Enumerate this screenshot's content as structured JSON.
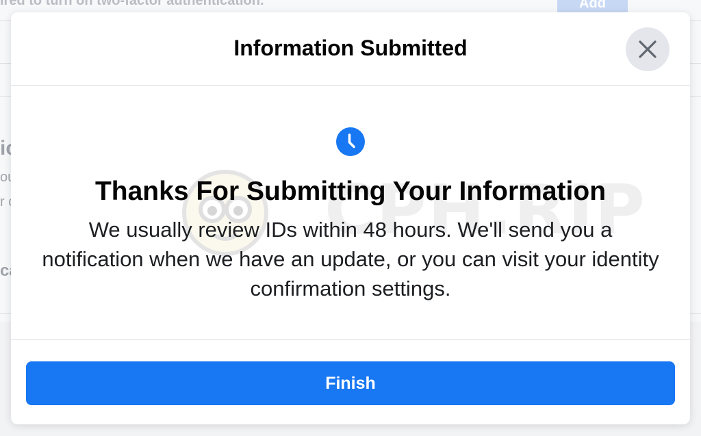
{
  "background": {
    "top_text": "ired to turn on two-factor authentication.",
    "add_button_label": "Add",
    "fragments": [
      "ic",
      "ou",
      "r c",
      "ca"
    ]
  },
  "modal": {
    "title": "Information Submitted",
    "close_icon": "close-icon",
    "status_icon": "clock-icon",
    "heading": "Thanks For Submitting Your Information",
    "body": "We usually review IDs within 48 hours. We'll send you a notification when we have an update, or you can visit your identity confirmation settings.",
    "finish_label": "Finish"
  },
  "watermark": {
    "text": "CPH.RIP"
  },
  "colors": {
    "accent": "#1877f2",
    "close_bg": "#e4e6eb",
    "text": "#050505"
  }
}
